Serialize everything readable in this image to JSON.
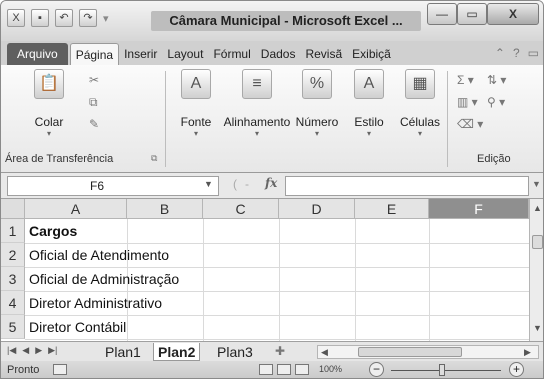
{
  "window": {
    "title": "Câmara Municipal - Microsoft Excel ...",
    "min_symbol": "—",
    "max_symbol": "▭",
    "close_symbol": "X"
  },
  "quick_access": {
    "save_icon": "save-icon",
    "undo_icon": "undo-icon",
    "redo_icon": "redo-icon"
  },
  "ribbon_tabs": [
    {
      "label": "Arquivo"
    },
    {
      "label": "Página"
    },
    {
      "label": "Inserir"
    },
    {
      "label": "Layout"
    },
    {
      "label": "Fórmul"
    },
    {
      "label": "Dados"
    },
    {
      "label": "Revisã"
    },
    {
      "label": "Exibiçã"
    }
  ],
  "ribbon": {
    "clipboard": {
      "paste_label": "Colar",
      "group_label": "Área de Transferência"
    },
    "font": {
      "label": "Fonte"
    },
    "alignment": {
      "label": "Alinhamento"
    },
    "number": {
      "label": "Número"
    },
    "style": {
      "label": "Estilo"
    },
    "cells": {
      "label": "Células"
    },
    "editing": {
      "group_label": "Edição"
    }
  },
  "formula_bar": {
    "name_box": "F6",
    "fx": "fx",
    "value": ""
  },
  "columns": [
    "A",
    "B",
    "C",
    "D",
    "E",
    "F"
  ],
  "selected_column": "F",
  "rows": [
    {
      "num": "1",
      "a": "Cargos",
      "bold": true
    },
    {
      "num": "2",
      "a": "Oficial de Atendimento"
    },
    {
      "num": "3",
      "a": "Oficial de Administração"
    },
    {
      "num": "4",
      "a": "Diretor Administrativo"
    },
    {
      "num": "5",
      "a": "Diretor Contábil"
    }
  ],
  "sheets": [
    {
      "label": "Plan1"
    },
    {
      "label": "Plan2",
      "active": true
    },
    {
      "label": "Plan3"
    }
  ],
  "status": {
    "ready": "Pronto",
    "zoom": "100%",
    "zoom_level_percent": 100
  }
}
